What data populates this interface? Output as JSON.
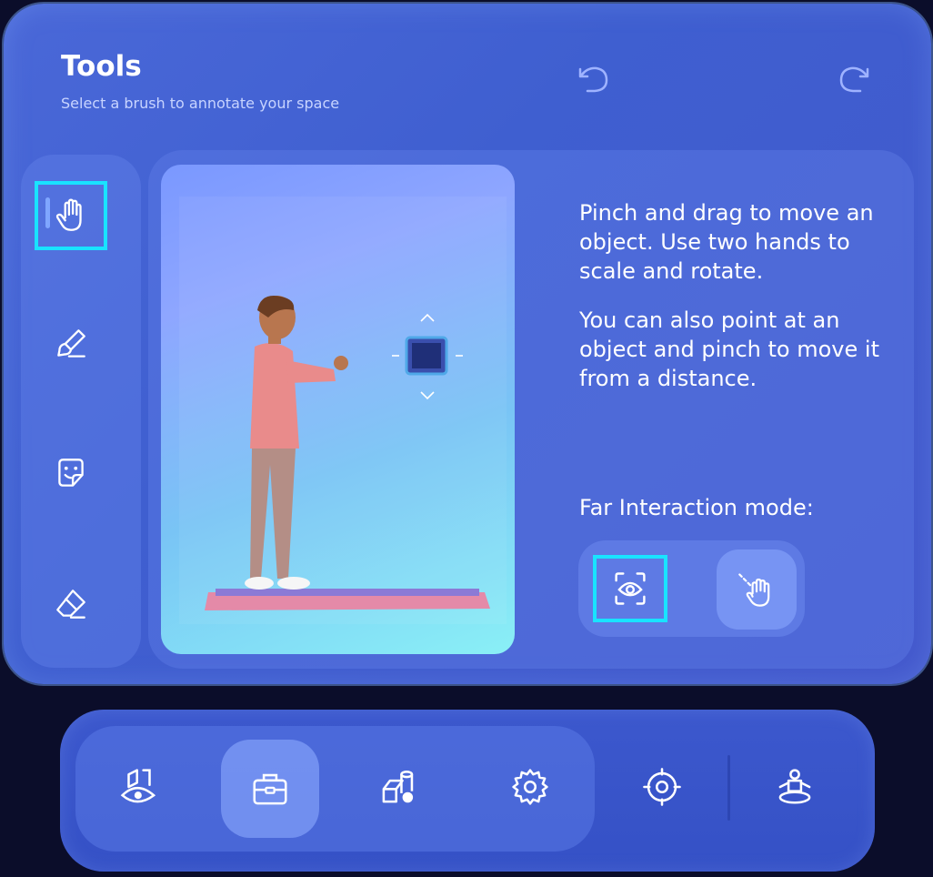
{
  "panel": {
    "title": "Tools",
    "subtitle": "Select a brush to annotate your space",
    "undo_icon": "undo-icon",
    "redo_icon": "redo-icon"
  },
  "tools_rail": {
    "items": [
      {
        "icon": "hand-icon",
        "selected": true
      },
      {
        "icon": "brush-icon",
        "selected": false
      },
      {
        "icon": "sticker-icon",
        "selected": false
      },
      {
        "icon": "eraser-icon",
        "selected": false
      }
    ]
  },
  "description": {
    "paragraph1": "Pinch and drag to move an object. Use two hands to scale and rotate.",
    "paragraph2": "You can also point at an object and pinch to move it from a distance."
  },
  "far_interaction": {
    "label": "Far Interaction mode:",
    "options": [
      {
        "icon": "eye-gaze-icon",
        "selected": true
      },
      {
        "icon": "hand-ray-icon",
        "selected": false
      }
    ]
  },
  "dock": {
    "items": [
      {
        "icon": "annotate-icon",
        "active": false
      },
      {
        "icon": "toolbox-icon",
        "active": true
      },
      {
        "icon": "objects-icon",
        "active": false
      },
      {
        "icon": "settings-icon",
        "active": false
      },
      {
        "icon": "target-icon",
        "active": false
      },
      {
        "icon": "person-icon",
        "active": false
      }
    ]
  },
  "colors": {
    "highlight": "#19e3ff",
    "panel": "#4562d2",
    "text": "#ffffff"
  }
}
